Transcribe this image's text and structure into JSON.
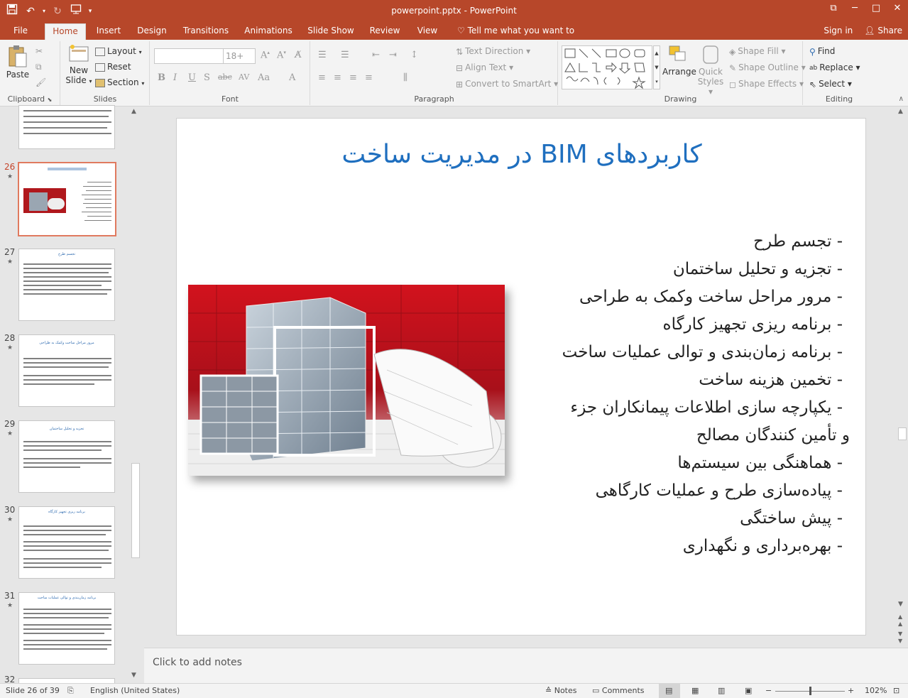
{
  "window": {
    "title": "powerpoint.pptx - PowerPoint",
    "restore_glyph": "⧉",
    "minimize_glyph": "─",
    "maximize_glyph": "□",
    "close_glyph": "✕"
  },
  "ribbon_tabs": [
    "File",
    "Home",
    "Insert",
    "Design",
    "Transitions",
    "Animations",
    "Slide Show",
    "Review",
    "View"
  ],
  "tell_me": "Tell me what you want to do...",
  "account": {
    "signin": "Sign in",
    "share": "Share"
  },
  "clipboard": {
    "paste": "Paste",
    "group": "Clipboard"
  },
  "slides_group": {
    "new_slide_1": "New",
    "new_slide_2": "Slide",
    "layout": "Layout",
    "reset": "Reset",
    "section": "Section",
    "group": "Slides"
  },
  "font_group": {
    "size": "18+",
    "group": "Font"
  },
  "paragraph_group": {
    "text_direction": "Text Direction",
    "align_text": "Align Text",
    "convert_smartart": "Convert to SmartArt",
    "group": "Paragraph"
  },
  "drawing_group": {
    "arrange": "Arrange",
    "quick_1": "Quick",
    "quick_2": "Styles",
    "shape_fill": "Shape Fill",
    "shape_outline": "Shape Outline",
    "shape_effects": "Shape Effects",
    "group": "Drawing"
  },
  "editing_group": {
    "find": "Find",
    "replace": "Replace",
    "select": "Select",
    "group": "Editing"
  },
  "thumbnails": [
    {
      "num": "26"
    },
    {
      "num": "27",
      "title": "تجسم طرح"
    },
    {
      "num": "28",
      "title": "مرور مراحل ساخت وکمک به طراحی"
    },
    {
      "num": "29",
      "title": "تجزیه و تحلیل ساختمان"
    },
    {
      "num": "30",
      "title": "برنامه ریزی تجهیز کارگاه"
    },
    {
      "num": "31",
      "title": "برنامه زمان‌بندی و توالی عملیات ساخت"
    },
    {
      "num": "32"
    }
  ],
  "slide": {
    "title": "کاربردهای BIM در مدیریت ساخت",
    "bullets": [
      "- تجسم طرح",
      "- تجزیه و تحلیل ساختمان",
      "- مرور مراحل ساخت وکمک به طراحی",
      "- برنامه ریزی تجهیز کارگاه",
      "- برنامه زمان‌بندی و توالی عملیات ساخت",
      "- تخمین هزینه ساخت",
      "- یکپارچه سازی اطلاعات پیمانکاران جزء",
      "و تأمین کنندگان مصالح",
      "- هماهنگی بین سیستم‌ها",
      "- پیاده‌سازی طرح و عملیات کارگاهی",
      "- پیش ساختگی",
      "- بهره‌برداری و نگهداری"
    ]
  },
  "notes_placeholder": "Click to add notes",
  "status": {
    "slide_info": "Slide 26 of 39",
    "language": "English (United States)",
    "notes": "Notes",
    "comments": "Comments",
    "zoom": "102%"
  }
}
